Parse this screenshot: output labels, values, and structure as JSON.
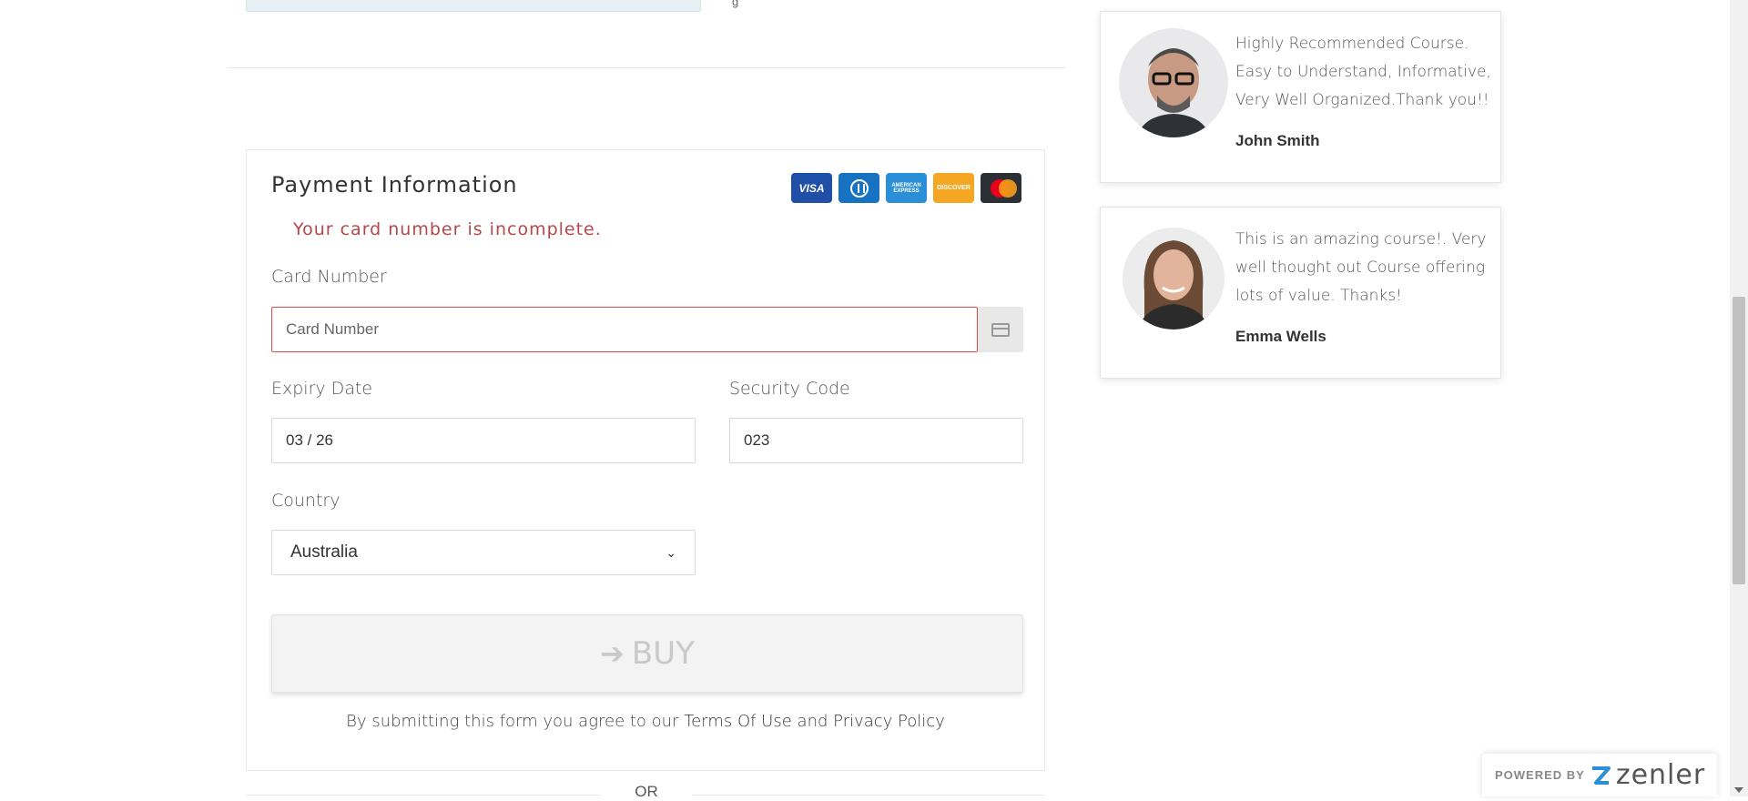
{
  "top_sliver_text": "g",
  "payment": {
    "title": "Payment Information",
    "error": "Your card number is incomplete.",
    "logos": {
      "visa": "VISA",
      "amex": "AMERICAN EXPRESS",
      "discover": "DISCOVER"
    },
    "card_number_label": "Card Number",
    "card_number_placeholder": "Card Number",
    "expiry_label": "Expiry Date",
    "expiry_value": "03 / 26",
    "security_label": "Security Code",
    "security_value": "023",
    "country_label": "Country",
    "country_value": "Australia",
    "buy_label": "BUY",
    "terms_prefix": "By submitting this form you agree to our",
    "terms_link": "Terms Of Use",
    "terms_and": "and",
    "privacy_link": "Privacy Policy",
    "or_text": "OR"
  },
  "testimonials": [
    {
      "quote": "Highly Recommended Course. Easy to Understand, Informative, Very Well Organized.Thank you!!",
      "author": "John Smith"
    },
    {
      "quote": "This is an amazing course!. Very well thought out Course offering lots of value. Thanks!",
      "author": "Emma Wells"
    }
  ],
  "powered": {
    "label": "POWERED BY",
    "brand": "zenler"
  },
  "colors": {
    "error": "#b5484a",
    "error_border": "#e24b4b",
    "visa": "#1f4fa6",
    "discover": "#f5a623"
  }
}
